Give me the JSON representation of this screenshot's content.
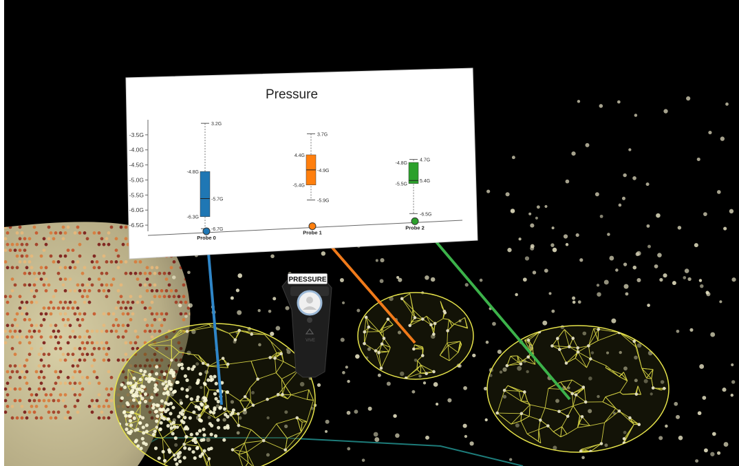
{
  "scene": {
    "background": "#000000",
    "pointcloud_color": "#e8e4c4",
    "wireframe_color": "#e6e34a",
    "ring_color": "#1d7c7a"
  },
  "controller": {
    "label": "PRESSURE",
    "icon": "vr-controller-icon",
    "brand_icon": "vive-logo-icon"
  },
  "chart_data": {
    "type": "box",
    "title": "Pressure",
    "categories": [
      "Probe 0",
      "Probe 1",
      "Probe 2"
    ],
    "y_tick_labels": [
      "-3.5G",
      "-4.0G",
      "-4.5G",
      "-5.0G",
      "-5.5G",
      "-6.0G",
      "-6.5G"
    ],
    "ylim": [
      -6.75,
      -3.0
    ],
    "boxes": [
      {
        "category": "Probe 0",
        "color": "#1f77b4",
        "max": -3.2,
        "q3": -4.8,
        "median": -5.7,
        "q1": -6.3,
        "min": -6.7,
        "labels": {
          "max": "3.2G",
          "q3": "-4.8G",
          "median": "-5.7G",
          "q1": "-6.3G",
          "min": "-6.7G"
        }
      },
      {
        "category": "Probe 1",
        "color": "#ff7f0e",
        "max": -3.7,
        "q3": -4.4,
        "median": -4.9,
        "q1": -5.4,
        "min": -5.9,
        "labels": {
          "max": "3.7G",
          "q3": "4.4G",
          "median": "-4.9G",
          "q1": "-5.4G",
          "min": "-5.9G"
        }
      },
      {
        "category": "Probe 2",
        "color": "#2ca02c",
        "max": -4.7,
        "q3": -4.8,
        "median": -5.4,
        "q1": -5.5,
        "min": -6.5,
        "labels": {
          "max": "4.7G",
          "q3": "-4.8G",
          "median": "5.4G",
          "q1": "-5.5G",
          "min": "-6.5G"
        }
      }
    ]
  }
}
